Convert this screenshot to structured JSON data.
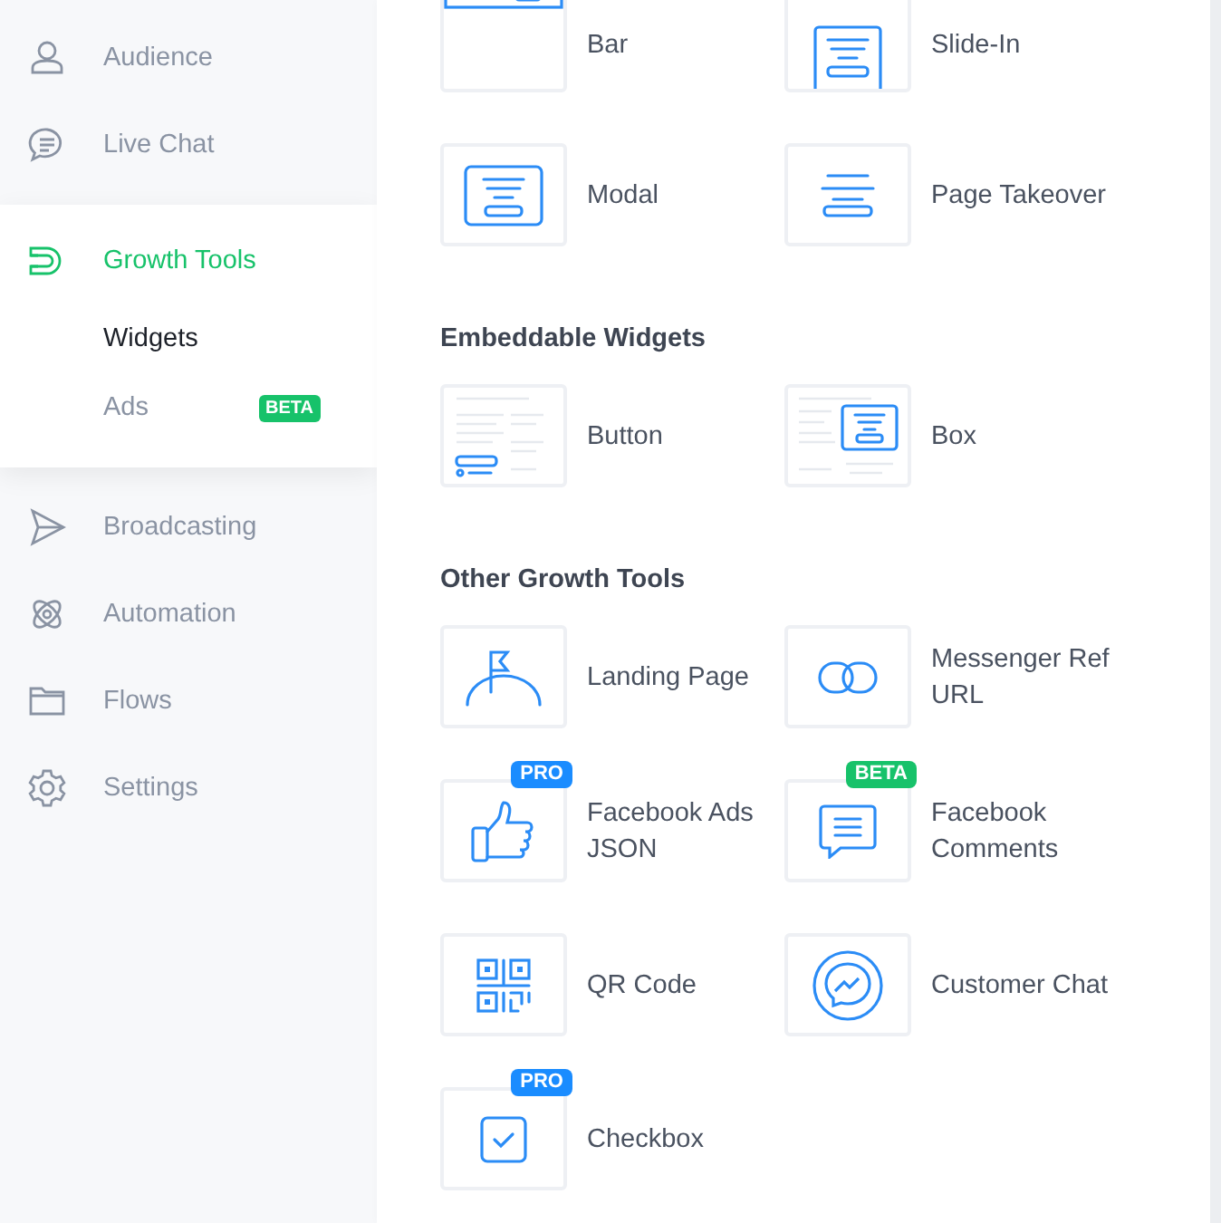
{
  "sidebar": {
    "items": [
      {
        "label": "Audience",
        "kind": "person",
        "selected": false
      },
      {
        "label": "Live Chat",
        "kind": "chat",
        "selected": false
      },
      {
        "label": "Growth Tools",
        "kind": "magnet",
        "selected": true,
        "children": [
          {
            "label": "Widgets",
            "selected": true
          },
          {
            "label": "Ads",
            "selected": false,
            "badge": {
              "text": "BETA",
              "color": "#17c26a"
            }
          }
        ]
      },
      {
        "label": "Broadcasting",
        "kind": "send",
        "selected": false
      },
      {
        "label": "Automation",
        "kind": "atom",
        "selected": false
      },
      {
        "label": "Flows",
        "kind": "folder",
        "selected": false
      },
      {
        "label": "Settings",
        "kind": "gear",
        "selected": false
      }
    ]
  },
  "sections": [
    {
      "tiles": [
        {
          "label": "Bar",
          "kind": "bar"
        },
        {
          "label": "Slide-In",
          "kind": "slidein"
        },
        {
          "label": "Modal",
          "kind": "modal"
        },
        {
          "label": "Page Takeover",
          "kind": "takeover"
        }
      ]
    },
    {
      "title": "Embeddable Widgets",
      "tiles": [
        {
          "label": "Button",
          "kind": "button"
        },
        {
          "label": "Box",
          "kind": "box"
        }
      ]
    },
    {
      "title": "Other Growth Tools",
      "tiles": [
        {
          "label": "Landing Page",
          "kind": "landing"
        },
        {
          "label": "Messenger Ref URL",
          "kind": "link"
        },
        {
          "label": "Facebook Ads JSON",
          "kind": "thumb",
          "badge": {
            "text": "PRO",
            "color": "#1a8cff"
          }
        },
        {
          "label": "Facebook Comments",
          "kind": "comment",
          "badge": {
            "text": "BETA",
            "color": "#17c26a"
          }
        },
        {
          "label": "QR Code",
          "kind": "qr"
        },
        {
          "label": "Customer Chat",
          "kind": "messenger"
        },
        {
          "label": "Checkbox",
          "kind": "checkbox",
          "badge": {
            "text": "PRO",
            "color": "#1a8cff"
          }
        }
      ]
    }
  ]
}
